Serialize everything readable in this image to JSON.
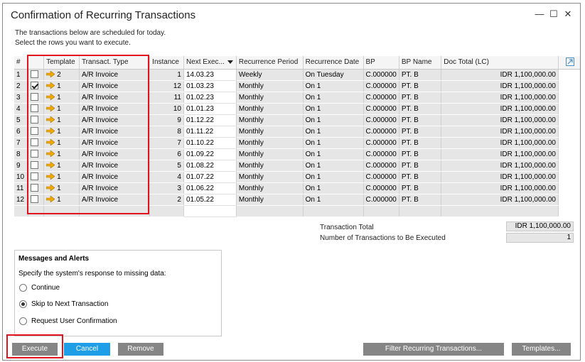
{
  "window": {
    "title": "Confirmation of Recurring Transactions",
    "minimize_glyph": "—",
    "maximize_glyph": "☐",
    "close_glyph": "✕"
  },
  "intro": {
    "line1": "The transactions below are scheduled for today.",
    "line2": "Select the rows you want to execute."
  },
  "grid": {
    "columns": [
      "#",
      "",
      "Template",
      "Transact. Type",
      "Instance",
      "Next Exec...",
      "Recurrence Period",
      "Recurrence Date",
      "BP",
      "BP Name",
      "Doc Total (LC)"
    ],
    "rows": [
      {
        "num": "1",
        "checked": false,
        "template": "2",
        "type": "A/R Invoice",
        "instance": "1",
        "next": "14.03.23",
        "period": "Weekly",
        "date": "On Tuesday",
        "bp": "C.000000",
        "bp_name": "PT. B",
        "total": "IDR 1,100,000.00"
      },
      {
        "num": "2",
        "checked": true,
        "template": "1",
        "type": "A/R Invoice",
        "instance": "12",
        "next": "01.03.23",
        "period": "Monthly",
        "date": "On 1",
        "bp": "C.000000",
        "bp_name": "PT. B",
        "total": "IDR 1,100,000.00"
      },
      {
        "num": "3",
        "checked": false,
        "template": "1",
        "type": "A/R Invoice",
        "instance": "11",
        "next": "01.02.23",
        "period": "Monthly",
        "date": "On 1",
        "bp": "C.000000",
        "bp_name": "PT. B",
        "total": "IDR 1,100,000.00"
      },
      {
        "num": "4",
        "checked": false,
        "template": "1",
        "type": "A/R Invoice",
        "instance": "10",
        "next": "01.01.23",
        "period": "Monthly",
        "date": "On 1",
        "bp": "C.000000",
        "bp_name": "PT. B",
        "total": "IDR 1,100,000.00"
      },
      {
        "num": "5",
        "checked": false,
        "template": "1",
        "type": "A/R Invoice",
        "instance": "9",
        "next": "01.12.22",
        "period": "Monthly",
        "date": "On 1",
        "bp": "C.000000",
        "bp_name": "PT. B",
        "total": "IDR 1,100,000.00"
      },
      {
        "num": "6",
        "checked": false,
        "template": "1",
        "type": "A/R Invoice",
        "instance": "8",
        "next": "01.11.22",
        "period": "Monthly",
        "date": "On 1",
        "bp": "C.000000",
        "bp_name": "PT. B",
        "total": "IDR 1,100,000.00"
      },
      {
        "num": "7",
        "checked": false,
        "template": "1",
        "type": "A/R Invoice",
        "instance": "7",
        "next": "01.10.22",
        "period": "Monthly",
        "date": "On 1",
        "bp": "C.000000",
        "bp_name": "PT. B",
        "total": "IDR 1,100,000.00"
      },
      {
        "num": "8",
        "checked": false,
        "template": "1",
        "type": "A/R Invoice",
        "instance": "6",
        "next": "01.09.22",
        "period": "Monthly",
        "date": "On 1",
        "bp": "C.000000",
        "bp_name": "PT. B",
        "total": "IDR 1,100,000.00"
      },
      {
        "num": "9",
        "checked": false,
        "template": "1",
        "type": "A/R Invoice",
        "instance": "5",
        "next": "01.08.22",
        "period": "Monthly",
        "date": "On 1",
        "bp": "C.000000",
        "bp_name": "PT. B",
        "total": "IDR 1,100,000.00"
      },
      {
        "num": "10",
        "checked": false,
        "template": "1",
        "type": "A/R Invoice",
        "instance": "4",
        "next": "01.07.22",
        "period": "Monthly",
        "date": "On 1",
        "bp": "C.000000",
        "bp_name": "PT. B",
        "total": "IDR 1,100,000.00"
      },
      {
        "num": "11",
        "checked": false,
        "template": "1",
        "type": "A/R Invoice",
        "instance": "3",
        "next": "01.06.22",
        "period": "Monthly",
        "date": "On 1",
        "bp": "C.000000",
        "bp_name": "PT. B",
        "total": "IDR 1,100,000.00"
      },
      {
        "num": "12",
        "checked": false,
        "template": "1",
        "type": "A/R Invoice",
        "instance": "2",
        "next": "01.05.22",
        "period": "Monthly",
        "date": "On 1",
        "bp": "C.000000",
        "bp_name": "PT. B",
        "total": "IDR 1,100,000.00"
      }
    ]
  },
  "totals": {
    "transaction_total_label": "Transaction Total",
    "transaction_total_value": "IDR 1,100,000.00",
    "count_label": "Number of Transactions to Be Executed",
    "count_value": "1"
  },
  "messages": {
    "title": "Messages and Alerts",
    "description": "Specify the system's response to missing data:",
    "options": [
      {
        "label": "Continue",
        "selected": false
      },
      {
        "label": "Skip to Next Transaction",
        "selected": true
      },
      {
        "label": "Request User Confirmation",
        "selected": false
      }
    ]
  },
  "buttons": {
    "execute": "Execute",
    "cancel": "Cancel",
    "remove": "Remove",
    "filter": "Filter Recurring Transactions...",
    "templates": "Templates..."
  },
  "colors": {
    "highlight": "#e0141e",
    "button_blue": "#1e9ee6",
    "button_grey": "#858585",
    "arrow_icon": "#f0a800"
  }
}
